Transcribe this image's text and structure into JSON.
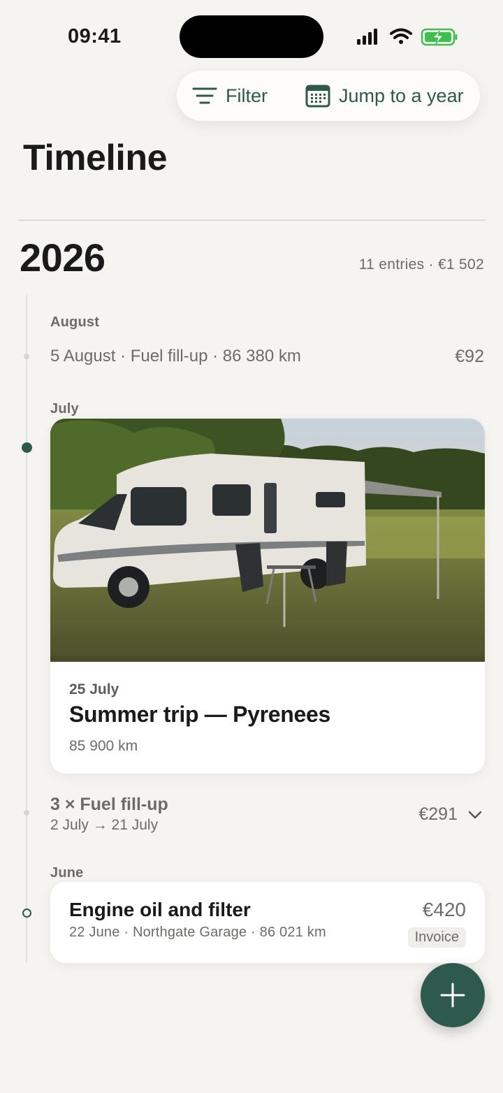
{
  "status_bar": {
    "time": "09:41"
  },
  "toolbar": {
    "filter_label": "Filter",
    "jump_label": "Jump to a year"
  },
  "page_title": "Timeline",
  "year": {
    "label": "2026",
    "summary": "11 entries · €1 502"
  },
  "august": {
    "label": "August",
    "entry": {
      "text": "5 August · Fuel fill-up · 86 380 km",
      "amount": "€92"
    }
  },
  "july": {
    "label": "July",
    "trip": {
      "date": "25 July",
      "title": "Summer trip — Pyrenees",
      "km": "85 900 km"
    },
    "group": {
      "title": "3 × Fuel fill-up",
      "range": "2 July → 21 July",
      "amount": "€291"
    }
  },
  "june": {
    "label": "June",
    "service": {
      "title": "Engine oil and filter",
      "sub": "22 June · Northgate Garage · 86 021 km",
      "amount": "€420",
      "badge": "Invoice"
    }
  },
  "colors": {
    "accent": "#2d5a4c",
    "background": "#f5f4f0",
    "card": "#ffffff",
    "muted": "#6b6b68"
  },
  "icons": [
    "signal-icon",
    "wifi-icon",
    "battery-charging-icon",
    "filter-icon",
    "calendar-icon",
    "chevron-down-icon",
    "plus-icon"
  ]
}
